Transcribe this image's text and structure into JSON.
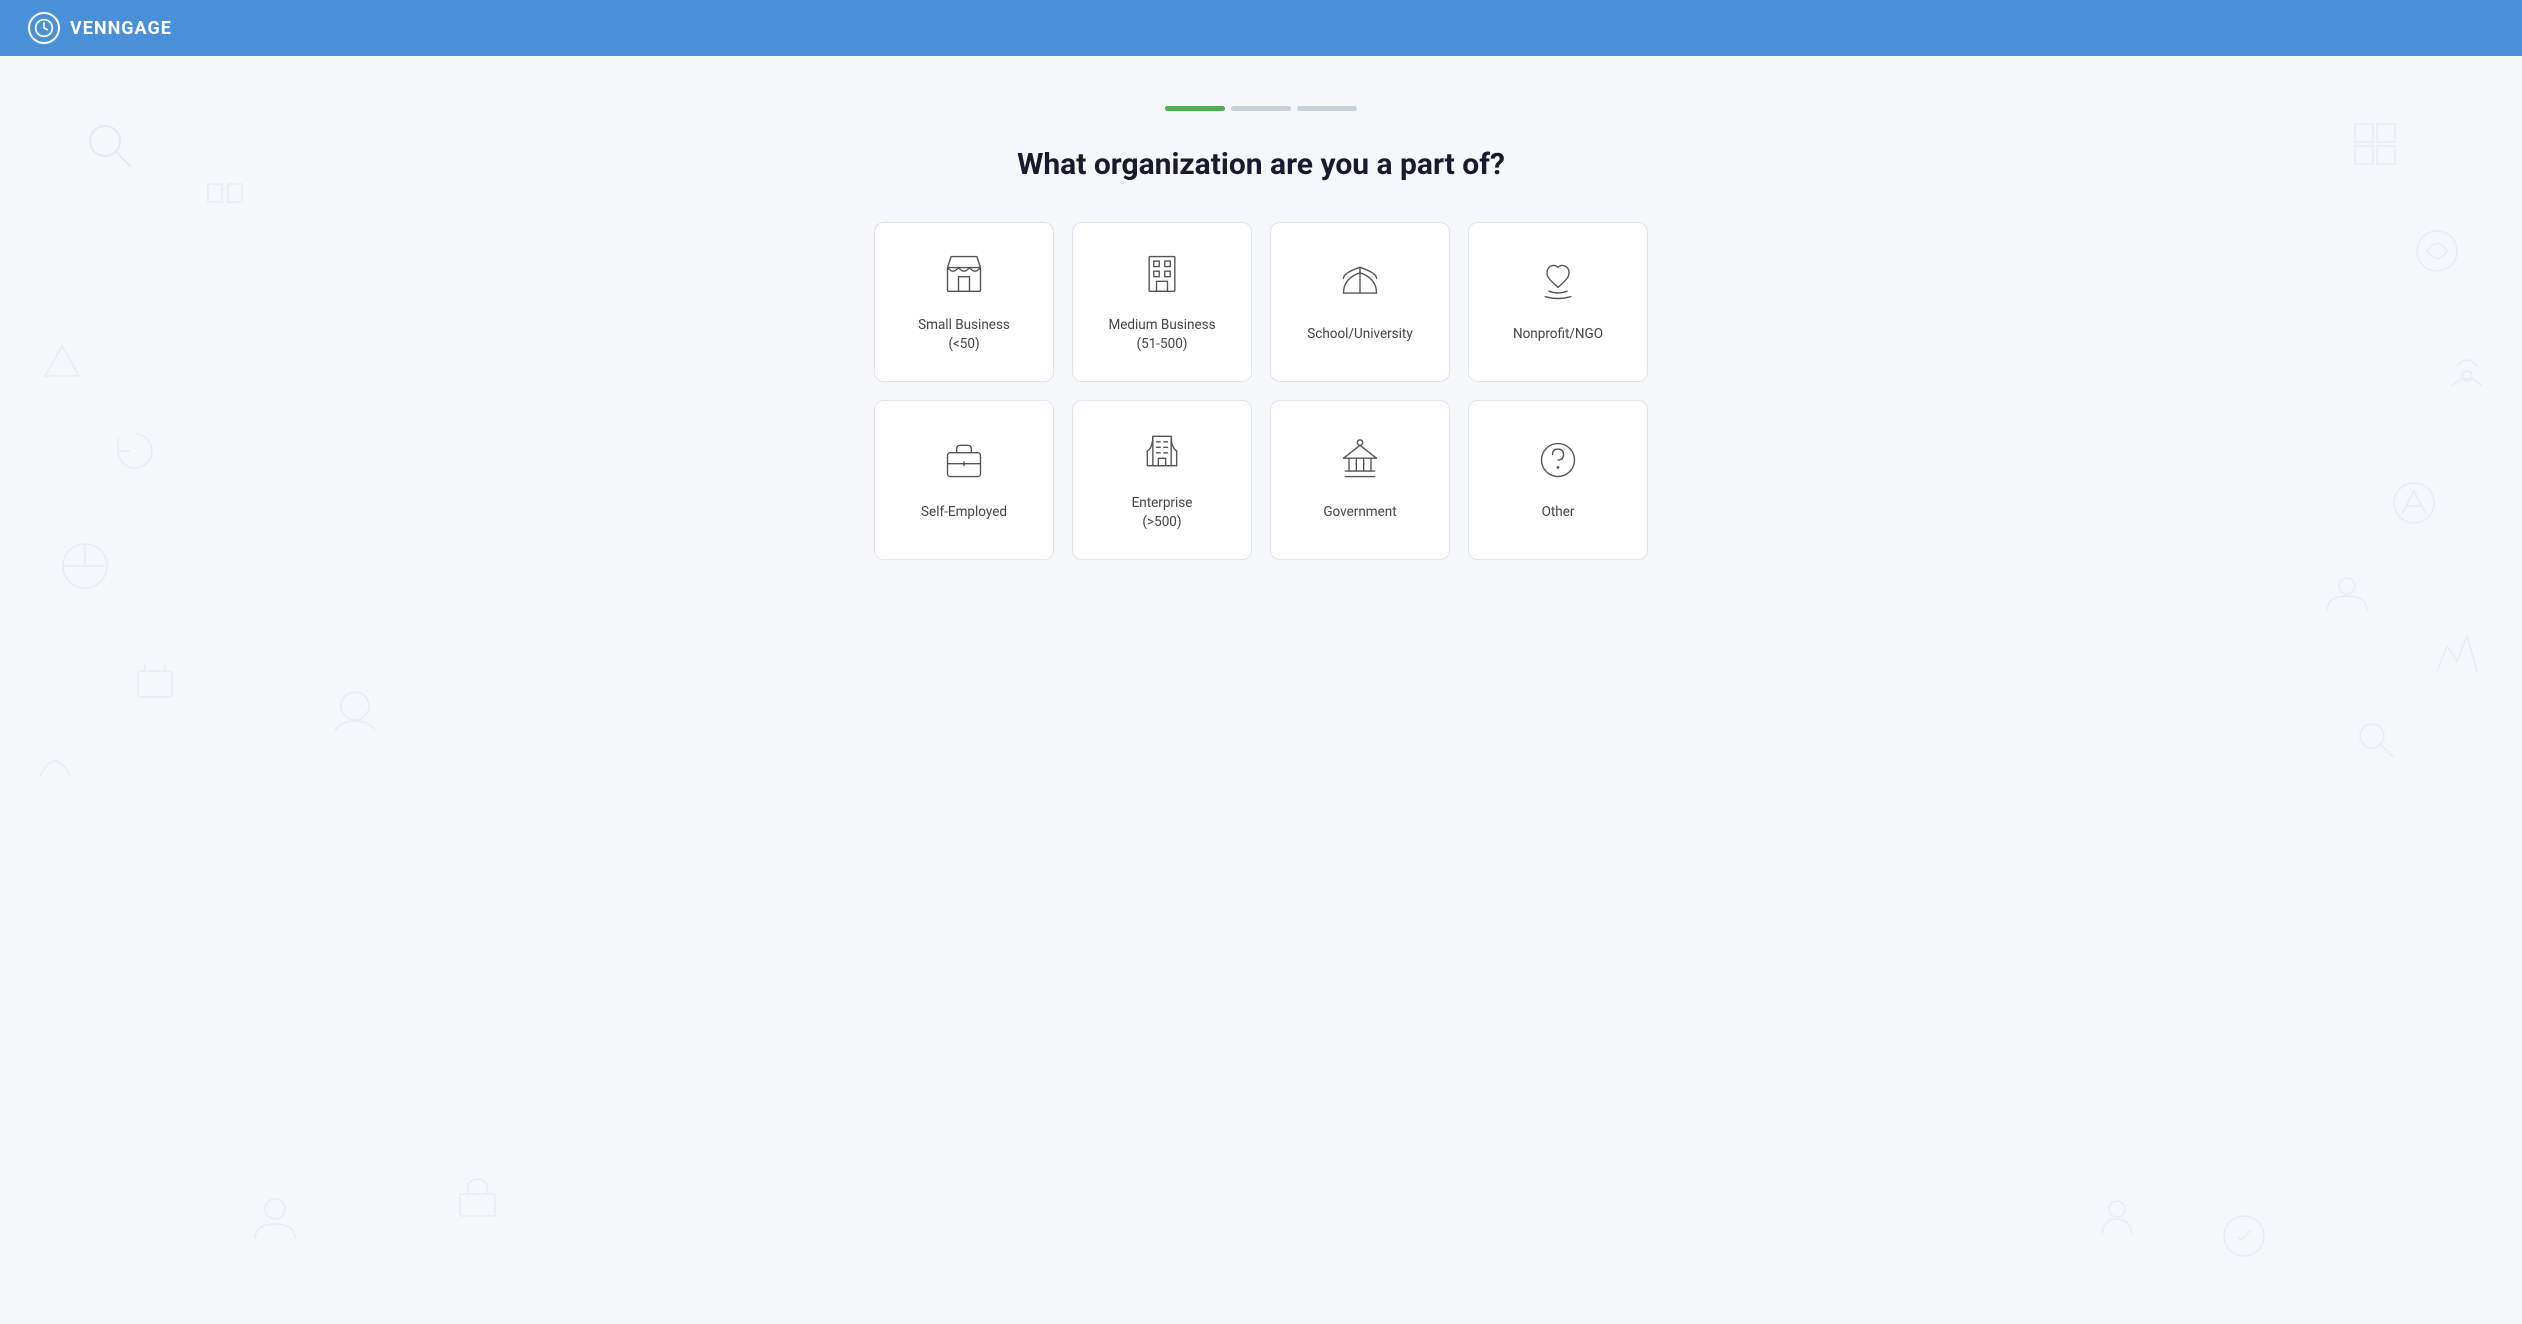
{
  "header": {
    "logo_text": "VENNGAGE",
    "logo_icon": "⏱"
  },
  "progress": {
    "steps": [
      {
        "id": "step1",
        "state": "active"
      },
      {
        "id": "step2",
        "state": "inactive"
      },
      {
        "id": "step3",
        "state": "inactive"
      }
    ]
  },
  "page": {
    "title": "What organization are you a part of?"
  },
  "organizations": [
    {
      "id": "small-business",
      "label": "Small Business\n(<50)",
      "label_line1": "Small Business",
      "label_line2": "(<50)",
      "icon_type": "store"
    },
    {
      "id": "medium-business",
      "label": "Medium Business\n(51-500)",
      "label_line1": "Medium Business",
      "label_line2": "(51-500)",
      "icon_type": "building"
    },
    {
      "id": "school-university",
      "label": "School/University",
      "label_line1": "School/University",
      "label_line2": "",
      "icon_type": "school"
    },
    {
      "id": "nonprofit-ngo",
      "label": "Nonprofit/NGO",
      "label_line1": "Nonprofit/NGO",
      "label_line2": "",
      "icon_type": "nonprofit"
    },
    {
      "id": "self-employed",
      "label": "Self-Employed",
      "label_line1": "Self-Employed",
      "label_line2": "",
      "icon_type": "briefcase"
    },
    {
      "id": "enterprise",
      "label": "Enterprise\n(>500)",
      "label_line1": "Enterprise",
      "label_line2": "(>500)",
      "icon_type": "enterprise"
    },
    {
      "id": "government",
      "label": "Government",
      "label_line1": "Government",
      "label_line2": "",
      "icon_type": "government"
    },
    {
      "id": "other",
      "label": "Other",
      "label_line1": "Other",
      "label_line2": "",
      "icon_type": "question"
    }
  ]
}
